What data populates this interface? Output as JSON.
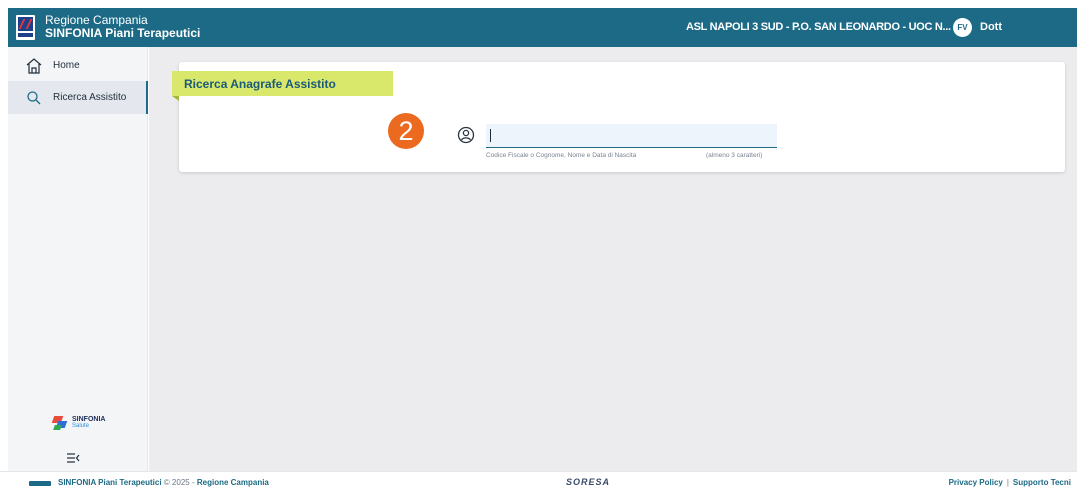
{
  "header": {
    "title_line1": "Regione Campania",
    "title_line2": "SINFONIA Piani Terapeutici",
    "organization": "ASL NAPOLI 3 SUD - P.O. SAN LEONARDO - UOC N...",
    "avatar_initials": "FV",
    "user_name": "Dott",
    "bar_color": "#1c6a85"
  },
  "sidebar": {
    "items": [
      {
        "label": "Home",
        "icon": "home-icon"
      },
      {
        "label": "Ricerca Assistito",
        "icon": "search-icon"
      }
    ],
    "brand_name": "SINFONIA",
    "brand_sub": "Salute"
  },
  "main": {
    "card_title": "Ricerca Anagrafe Assistito",
    "step_number": "2",
    "search": {
      "value": "",
      "hint": "Codice Fiscale o Cognome, Nome e Data di Nascita",
      "hint_min": "(almeno 3 caratteri)"
    },
    "accent_color": "#d9e86a",
    "step_color": "#ec6a1f"
  },
  "footer": {
    "app_name": "SINFONIA Piani Terapeutici",
    "copyright": "© 2025 -",
    "region": "Regione Campania",
    "partner": "SORESA",
    "privacy": "Privacy Policy",
    "separator": "|",
    "support": "Supporto Tecni"
  }
}
